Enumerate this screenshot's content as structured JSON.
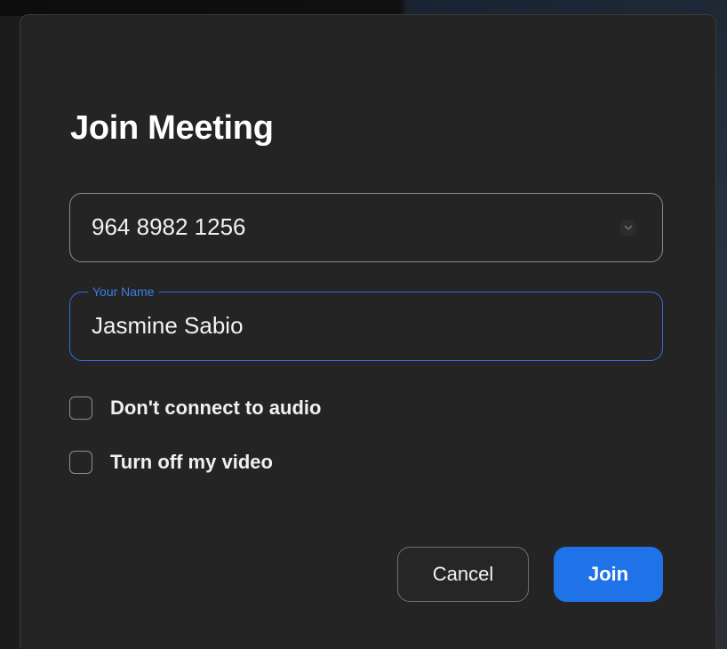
{
  "dialog": {
    "title": "Join Meeting"
  },
  "meeting_id": {
    "value": "964 8982 1256",
    "dropdown_icon": "chevron-down-icon"
  },
  "name_field": {
    "label": "Your Name",
    "value": "Jasmine Sabio"
  },
  "options": [
    {
      "label": "Don't connect to audio",
      "checked": false
    },
    {
      "label": "Turn off my video",
      "checked": false
    }
  ],
  "buttons": {
    "cancel_label": "Cancel",
    "join_label": "Join"
  },
  "colors": {
    "dialog_background": "#242424",
    "accent": "#1f72e8",
    "focus_border": "#2e6fd8",
    "text": "#ffffff"
  }
}
